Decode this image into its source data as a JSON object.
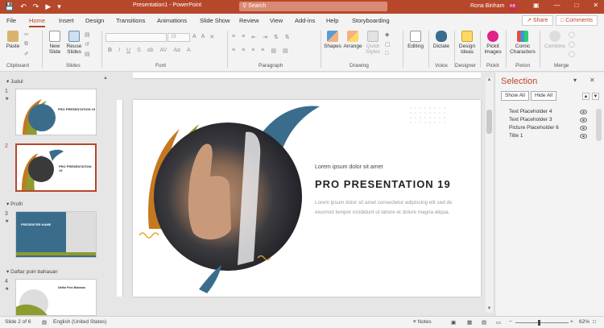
{
  "titlebar": {
    "qa_icons": [
      "save-icon",
      "undo-icon",
      "redo-icon",
      "start-from-beginning-icon",
      "customize-icon"
    ],
    "title": "Presentation1 - PowerPoint",
    "search_placeholder": "Search",
    "user_name": "Rona Binham",
    "user_initials": "RB",
    "window_buttons": [
      "ribbon-display-icon",
      "minimize-icon",
      "maximize-icon",
      "close-icon"
    ]
  },
  "tabs": [
    "File",
    "Home",
    "Insert",
    "Design",
    "Transitions",
    "Animations",
    "Slide Show",
    "Review",
    "View",
    "Add-ins",
    "Help",
    "Storyboarding"
  ],
  "active_tab": "Home",
  "share_label": "Share",
  "comments_label": "Comments",
  "ribbon": {
    "paste_label": "Paste",
    "new_slide_label": "New Slide",
    "reuse_slides_label": "Reuse Slides",
    "shapes_label": "Shapes",
    "arrange_label": "Arrange",
    "quick_styles_label": "Quick Styles",
    "editing_label": "Editing",
    "dictate_label": "Dictate",
    "design_ideas_label": "Design Ideas",
    "pickit_label": "Pickit Images",
    "comic_label": "Comic Characters",
    "combine_label": "Combine",
    "font_size": "28",
    "groups": {
      "clipboard": "Clipboard",
      "slides": "Slides",
      "font": "Font",
      "paragraph": "Paragraph",
      "drawing": "Drawing",
      "voice": "Voice",
      "designer": "Designer",
      "pickit": "Pickit",
      "pixton": "Pixton",
      "merge": "Merge"
    }
  },
  "thumbnails": {
    "sections": [
      "Judul",
      "Profil",
      "Daftar poin bahasan"
    ],
    "slides": [
      {
        "number": "1",
        "title": "PRO PRESENTATION 19"
      },
      {
        "number": "2",
        "title": "PRO PRESENTATION 19"
      },
      {
        "number": "3",
        "title": "PRESENTER NAME"
      },
      {
        "number": "4",
        "title": "Daftar Poin Bahasan"
      }
    ],
    "star": "★"
  },
  "slide": {
    "subtitle": "Lorem ipsum dolor sit amet",
    "title": "PRO PRESENTATION 19",
    "body": "Lorem ipsum dolor sit amet consectetur adipiscing elit sed do eiusmod tempor incididunt ut labore et dolore magna aliqua."
  },
  "selection_pane": {
    "heading": "Selection",
    "show_all": "Show All",
    "hide_all": "Hide All",
    "items": [
      "Text Placeholder 4",
      "Text Placeholder 3",
      "Picture Placeholder 6",
      "Title 1"
    ]
  },
  "status": {
    "slide_info": "Slide 2 of 6",
    "language": "English (United States)",
    "notes_label": "Notes",
    "zoom": "62%"
  },
  "colors": {
    "accent": "#b7472a",
    "slide_blue": "#3a6d8c",
    "slide_olive": "#8e9b2e",
    "slide_orange": "#c6781f"
  }
}
